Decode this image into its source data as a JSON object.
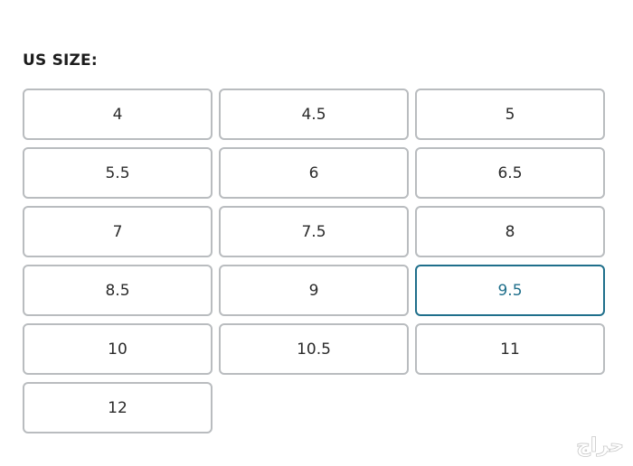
{
  "section": {
    "label": "US SIZE:"
  },
  "sizes": [
    {
      "label": "4",
      "selected": false
    },
    {
      "label": "4.5",
      "selected": false
    },
    {
      "label": "5",
      "selected": false
    },
    {
      "label": "5.5",
      "selected": false
    },
    {
      "label": "6",
      "selected": false
    },
    {
      "label": "6.5",
      "selected": false
    },
    {
      "label": "7",
      "selected": false
    },
    {
      "label": "7.5",
      "selected": false
    },
    {
      "label": "8",
      "selected": false
    },
    {
      "label": "8.5",
      "selected": false
    },
    {
      "label": "9",
      "selected": false
    },
    {
      "label": "9.5",
      "selected": true
    },
    {
      "label": "10",
      "selected": false
    },
    {
      "label": "10.5",
      "selected": false
    },
    {
      "label": "11",
      "selected": false
    },
    {
      "label": "12",
      "selected": false
    }
  ],
  "colors": {
    "border": "#b9bcbf",
    "selected_accent": "#1f6f8b",
    "text": "#2a2a2a"
  },
  "watermark": {
    "text": "حراج",
    "icon": "haraj-logo-watermark"
  }
}
